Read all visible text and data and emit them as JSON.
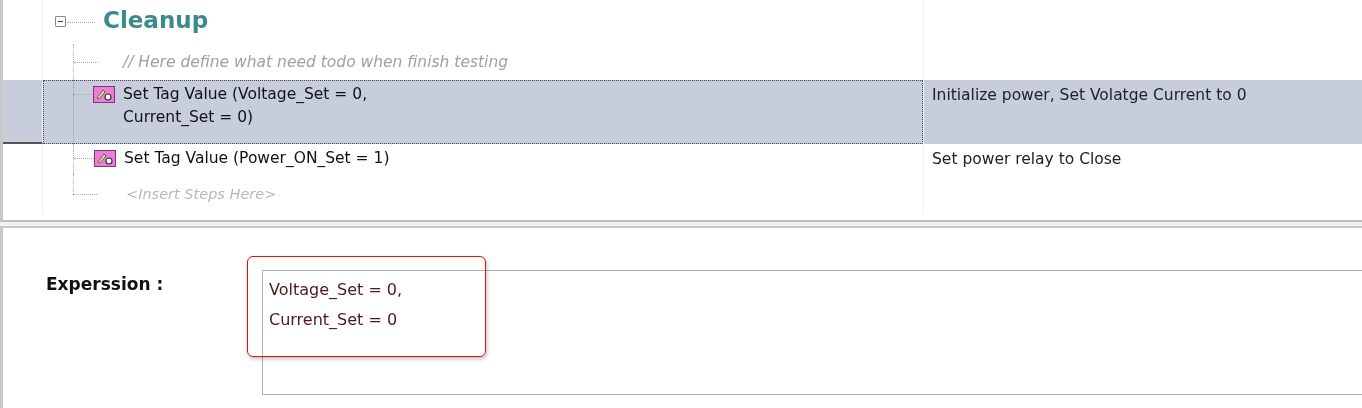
{
  "group": {
    "title": "Cleanup",
    "expanded": true,
    "comment": "// Here define what need todo when finish testing",
    "steps": [
      {
        "label": "Set Tag Value (Voltage_Set = 0,\nCurrent_Set = 0)",
        "description": "Initialize power, Set Volatge Current to 0",
        "selected": true
      },
      {
        "label": "Set Tag Value (Power_ON_Set = 1)",
        "description": "Set power relay to Close",
        "selected": false
      }
    ],
    "insert_hint": "<Insert Steps Here>"
  },
  "expression": {
    "label": "Experssion :",
    "value": "Voltage_Set = 0,\nCurrent_Set = 0",
    "highlighted": true
  }
}
